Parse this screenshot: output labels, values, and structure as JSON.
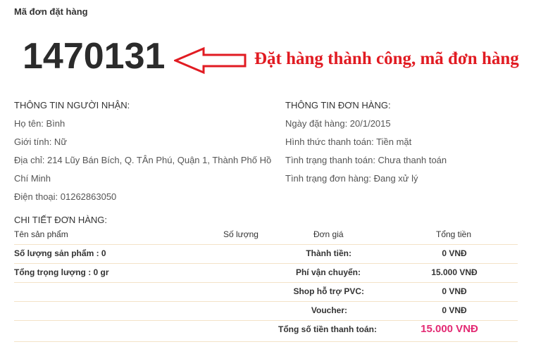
{
  "order": {
    "label": "Mã đơn đặt hàng",
    "number": "1470131",
    "success_message": "Đặt hàng thành công, mã đơn hàng"
  },
  "recipient": {
    "title": "THÔNG TIN NGƯỜI NHẬN:",
    "name": "Họ tên: Bình",
    "gender": "Giới tính: Nữ",
    "address_line1": "Địa chỉ: 214 Lũy Bán Bích, Q. TÂn Phú, Quận 1, Thành Phố Hồ",
    "address_line2": "Chí Minh",
    "phone": "Điện thoại: 01262863050"
  },
  "order_info": {
    "title": "THÔNG TIN ĐƠN HÀNG:",
    "date": "Ngày đặt hàng: 20/1/2015",
    "payment_method": "Hình thức thanh toán: Tiền mặt",
    "payment_status": "Tình trạng thanh toán: Chưa thanh toán",
    "order_status": "Tình trạng đơn hàng: Đang xử lý"
  },
  "details": {
    "title": "CHI TIẾT ĐƠN HÀNG:",
    "headers": [
      "Tên sản phẩm",
      "Số lượng",
      "Đơn giá",
      "Tổng tiền"
    ],
    "rows": [
      {
        "left": "Số lượng sản phẩm : 0",
        "label": "Thành tiền:",
        "value": "0 VNĐ"
      },
      {
        "left": "Tổng trọng lượng : 0 gr",
        "label": "Phí vận chuyển:",
        "value": "15.000 VNĐ"
      },
      {
        "left": "",
        "label": "Shop hỗ trợ PVC:",
        "value": "0 VNĐ"
      },
      {
        "left": "",
        "label": "Voucher:",
        "value": "0 VNĐ"
      },
      {
        "left": "",
        "label": "Tổng số tiền thanh toán:",
        "value": "15.000 VNĐ"
      }
    ]
  },
  "colors": {
    "accent_red": "#e11b22",
    "total_pink": "#e32a73",
    "row_border": "#f3e3c7"
  }
}
